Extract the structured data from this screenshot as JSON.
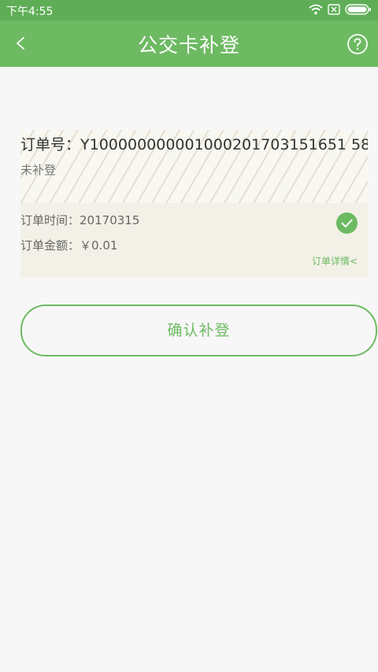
{
  "status_bar": {
    "time": "下午4:55",
    "icons": [
      "wifi-icon",
      "sim-blocked-icon",
      "battery-icon"
    ]
  },
  "nav": {
    "title": "公交卡补登",
    "back_icon": "chevron-left-icon",
    "help_icon": "help-circle-icon"
  },
  "order": {
    "number_label": "订单号：",
    "number": "Y100000000001000201703151651 58",
    "status": "未补登",
    "time_label": "订单时间：",
    "time": "20170315",
    "amount_label": "订单金额：",
    "amount": "￥0.01",
    "detail_link": "订单详情<",
    "status_icon": "check-circle-icon"
  },
  "confirm_button": {
    "label": "确认补登"
  },
  "colors": {
    "primary": "#6dba62",
    "status_bar": "#5fae57",
    "background": "#f7f7f7",
    "card": "#f3f1e7"
  }
}
